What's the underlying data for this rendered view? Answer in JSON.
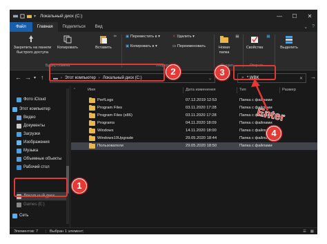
{
  "window": {
    "title": "Локальный диск (C:)",
    "controls": [
      "—",
      "☐",
      "✕"
    ]
  },
  "ribbon_tabs": [
    "Файл",
    "Главная",
    "Поделиться",
    "Вид"
  ],
  "ribbon": {
    "pin_label": "Закрепить на панели быстрого доступа",
    "copy_label": "Копировать",
    "paste_label": "Вставить",
    "move_to_label": "Переместить в",
    "delete_label": "Удалить",
    "copy_to_label": "Копировать в",
    "rename_label": "Переименовать",
    "new_folder_label": "Новая папка",
    "properties_label": "Свойства",
    "select_label": "Выделить",
    "groups": [
      "Буфер обмена",
      "Упорядочить",
      "Создать",
      "Открыть"
    ]
  },
  "address": {
    "segments": [
      "Этот компьютер",
      "Локальный диск (C:)"
    ],
    "search_value": "*.WBK"
  },
  "sidebar": {
    "items": [
      {
        "label": "Фото iCloud",
        "color": "#4aa3df"
      },
      {
        "label": "Этот компьютер",
        "color": "#5ab0e8"
      },
      {
        "label": "Видео",
        "color": "#7aa7d8"
      },
      {
        "label": "Документы",
        "color": "#c9c9c9"
      },
      {
        "label": "Загрузки",
        "color": "#4aa3df"
      },
      {
        "label": "Изображения",
        "color": "#6ab6e6"
      },
      {
        "label": "Музыка",
        "color": "#4aa3df"
      },
      {
        "label": "Объемные объекты",
        "color": "#5a9fd4"
      },
      {
        "label": "Рабочий стол",
        "color": "#3d8fd0"
      },
      {
        "label": "Локальный диск",
        "color": "#bdbdbd"
      },
      {
        "label": "Games (E:)",
        "color": "#888888"
      },
      {
        "label": "Сеть",
        "color": "#5ab0e8"
      }
    ]
  },
  "columns": {
    "name": "Имя",
    "date": "Дата изменения",
    "type": "Тип",
    "size": "Размер"
  },
  "files": [
    {
      "name": "PerfLogs",
      "date": "07.12.2019 12:53",
      "type": "Папка с файлами"
    },
    {
      "name": "Program Files",
      "date": "03.11.2020 17:28",
      "type": "Папка с файлами"
    },
    {
      "name": "Program Files (x86)",
      "date": "03.11.2020 17:28",
      "type": "Папка с файлами"
    },
    {
      "name": "Programs",
      "date": "04.11.2020 18:09",
      "type": "Папка с файлами"
    },
    {
      "name": "Windows",
      "date": "14.11.2020 18:00",
      "type": "Папка с файлами"
    },
    {
      "name": "Windows10Upgrade",
      "date": "29.05.2020 18:44",
      "type": "Папка с файлами"
    },
    {
      "name": "Пользователи",
      "date": "29.05.2020 18:50",
      "type": "Папка с файлами"
    }
  ],
  "status": {
    "count": "Элементов: 7",
    "selected": "Выбран 1 элемент"
  },
  "callouts": {
    "step1": "1",
    "step2": "2",
    "step3": "3",
    "step4": "4",
    "enter": "Enter"
  },
  "colors": {
    "accent": "#1a5da8",
    "callout": "#e53935",
    "folder": "#e8b84a",
    "background": "#191919"
  }
}
